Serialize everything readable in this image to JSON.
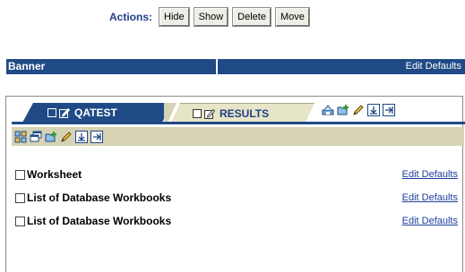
{
  "actions": {
    "label": "Actions:",
    "buttons": [
      "Hide",
      "Show",
      "Delete",
      "Move"
    ]
  },
  "banner": {
    "title": "Banner",
    "edit_link": "Edit Defaults"
  },
  "tabs": [
    {
      "label": "QATEST",
      "active": true
    },
    {
      "label": "RESULTS",
      "active": false
    }
  ],
  "tab_tools": [
    "customize-icon",
    "add-folder-icon",
    "edit-icon",
    "collapse-icon",
    "expand-icon"
  ],
  "toolbar_icons": [
    "layout-icon",
    "windows-icon",
    "add-icon",
    "edit-icon",
    "collapse-icon",
    "expand-icon"
  ],
  "items": [
    {
      "name": "Worksheet",
      "edit": "Edit Defaults"
    },
    {
      "name": "List of Database Workbooks",
      "edit": "Edit Defaults"
    },
    {
      "name": "List of Database Workbooks",
      "edit": "Edit Defaults"
    }
  ],
  "colors": {
    "primary": "#1f4a86",
    "toolbar": "#d6d3b5",
    "tab_inactive": "#e7e5c8",
    "link": "#1f3f9e"
  }
}
